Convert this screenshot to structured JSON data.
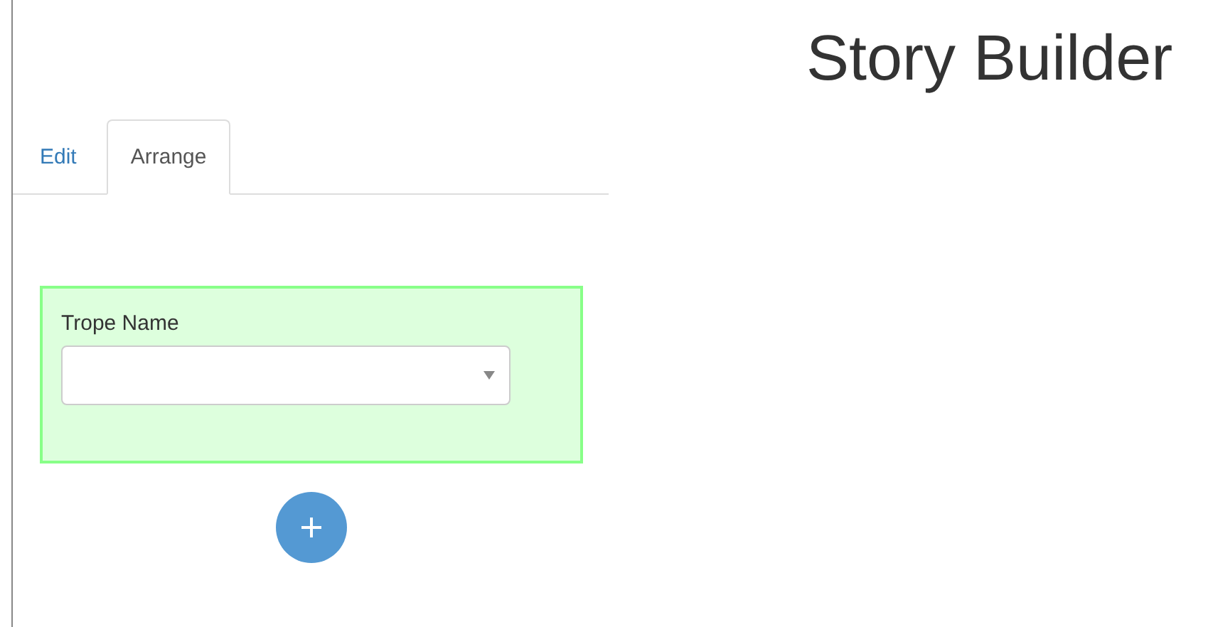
{
  "title": "Story Builder",
  "tabs": [
    {
      "label": "Edit",
      "selected": false
    },
    {
      "label": "Arrange",
      "selected": true
    }
  ],
  "trope_card": {
    "label": "Trope Name",
    "select": {
      "expanded": false
    }
  }
}
